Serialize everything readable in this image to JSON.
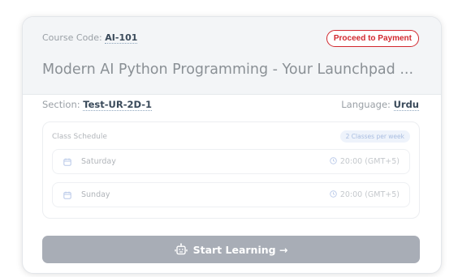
{
  "course": {
    "code_label": "Course Code:",
    "code_value": "AI-101",
    "title": "Modern AI Python Programming - Your Launchpad ...",
    "payment_button": "Proceed to Payment"
  },
  "meta": {
    "section_label": "Section:",
    "section_value": "Test-UR-2D-1",
    "language_label": "Language:",
    "language_value": "Urdu"
  },
  "schedule": {
    "title": "Class Schedule",
    "badge": "2 Classes per week",
    "days": [
      {
        "day": "Saturday",
        "time": "20:00 (GMT+5)"
      },
      {
        "day": "Sunday",
        "time": "20:00 (GMT+5)"
      }
    ]
  },
  "actions": {
    "start_label": "Start Learning →"
  },
  "colors": {
    "accent_red": "#d2282e",
    "button_gray": "#a8adb6",
    "icon_blue": "#b8c8e8"
  },
  "icons": {
    "calendar": "calendar-icon",
    "clock": "clock-icon",
    "robot": "robot-icon"
  }
}
